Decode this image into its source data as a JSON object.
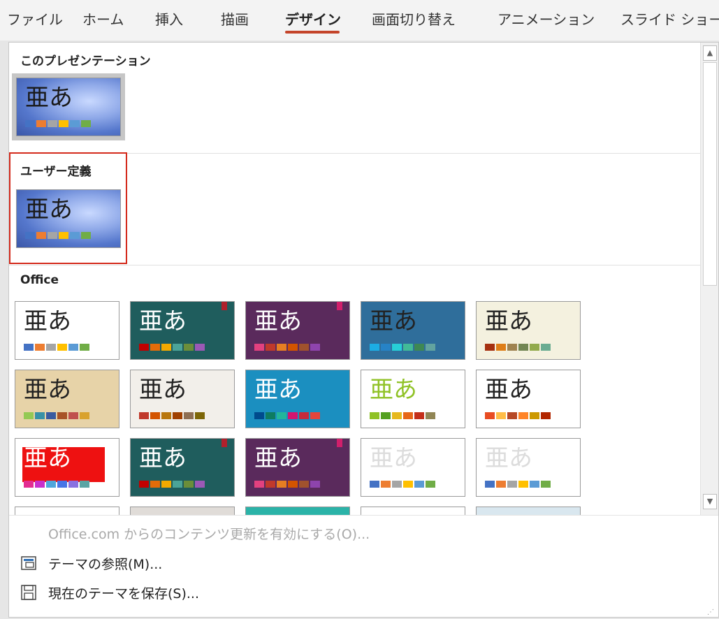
{
  "ribbon": {
    "tabs": [
      "ファイル",
      "ホーム",
      "挿入",
      "描画",
      "デザイン",
      "画面切り替え",
      "アニメーション",
      "スライド ショー"
    ],
    "active_tab": "デザイン"
  },
  "panel": {
    "sections": {
      "this_presentation": "このプレゼンテーション",
      "custom": "ユーザー定義",
      "office": "Office"
    },
    "sample_text": "亜あ",
    "themes": [
      {
        "bg": "#ffffff",
        "text_color": "#222222",
        "swatches": [
          "#4472c4",
          "#ed7d31",
          "#a5a5a5",
          "#ffc000",
          "#5b9bd5",
          "#70ad47"
        ]
      },
      {
        "bg": "#1f5d5d",
        "text_color": "#ffffff",
        "swatches": [
          "#c00000",
          "#e36c09",
          "#f2a900",
          "#4ba398",
          "#6b8e3a",
          "#9b59b6"
        ],
        "accent": "#b0202c"
      },
      {
        "bg": "#5a2a5c",
        "text_color": "#ffffff",
        "swatches": [
          "#e2417f",
          "#c0392b",
          "#e67e22",
          "#d35400",
          "#a0522d",
          "#8e44ad"
        ],
        "accent": "#d11f6b"
      },
      {
        "bg": "#2f6e9b",
        "text_color": "#222222",
        "swatches": [
          "#1cade4",
          "#2683c6",
          "#27ced7",
          "#42ba97",
          "#3e8853",
          "#62a39f"
        ]
      },
      {
        "bg": "#f4f1df",
        "text_color": "#222222",
        "swatches": [
          "#a53010",
          "#de7e18",
          "#9f8351",
          "#728653",
          "#92aa4c",
          "#6aac91"
        ]
      },
      {
        "bg": "#e7d3a8",
        "text_color": "#222222",
        "swatches": [
          "#94c954",
          "#3891a7",
          "#3a5ba0",
          "#a85327",
          "#c0504d",
          "#d9a22d"
        ]
      },
      {
        "bg": "#f2efea",
        "text_color": "#222222",
        "swatches": [
          "#c0392b",
          "#d35400",
          "#b9770e",
          "#a04000",
          "#8e6e53",
          "#7d6608"
        ]
      },
      {
        "bg": "#1b8fc0",
        "text_color": "#ffffff",
        "swatches": [
          "#004b8d",
          "#0e7c61",
          "#23b69b",
          "#d3166f",
          "#c82a3b",
          "#e4453c"
        ]
      },
      {
        "bg": "#ffffff",
        "text_color": "#90c226",
        "swatches": [
          "#90c226",
          "#54a021",
          "#e6b91e",
          "#e76618",
          "#c42f1a",
          "#918655"
        ]
      },
      {
        "bg": "#ffffff",
        "text_color": "#222222",
        "swatches": [
          "#e84c22",
          "#ffbd47",
          "#b64926",
          "#ff8427",
          "#cc9900",
          "#b22600"
        ]
      },
      {
        "bg": "#ffffff",
        "text_color": "#ffffff",
        "swatches": [
          "#e32d91",
          "#c830cc",
          "#4ea6dc",
          "#4775e7",
          "#8971e1",
          "#5ba4a4"
        ]
      },
      {
        "bg": "#1f5d5d",
        "text_color": "#ffffff",
        "swatches": [
          "#c00000",
          "#e36c09",
          "#f2a900",
          "#4ba398",
          "#6b8e3a",
          "#9b59b6"
        ],
        "accent": "#b0202c"
      },
      {
        "bg": "#5a2a5c",
        "text_color": "#ffffff",
        "swatches": [
          "#e2417f",
          "#c0392b",
          "#e67e22",
          "#d35400",
          "#a0522d",
          "#8e44ad"
        ],
        "accent": "#d11f6b"
      },
      {
        "bg": "#ffffff",
        "text_color": "#dcdcdc",
        "swatches": [
          "#4472c4",
          "#ed7d31",
          "#a5a5a5",
          "#ffc000",
          "#5b9bd5",
          "#70ad47"
        ]
      },
      {
        "bg": "#ffffff",
        "text_color": "#dcdcdc",
        "swatches": [
          "#4472c4",
          "#ed7d31",
          "#a5a5a5",
          "#ffc000",
          "#5b9bd5",
          "#70ad47"
        ]
      }
    ]
  },
  "menu": {
    "enable_updates": "Office.com からのコンテンツ更新を有効にする(O)...",
    "browse_themes": "テーマの参照(M)...",
    "save_theme": "現在のテーマを保存(S)..."
  },
  "colors": {
    "active_tab_underline": "#c4442a",
    "highlight_box": "#d42a1c"
  }
}
